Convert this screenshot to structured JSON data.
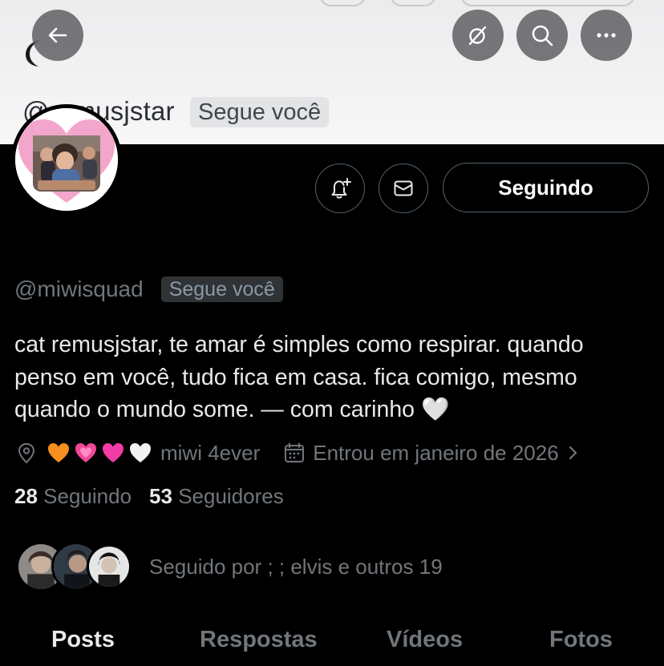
{
  "banner": {
    "back_icon": "arrow-left-icon",
    "moon_icon": "crescent-moon-icon",
    "ghost_handle": "@remusjstar",
    "ghost_badge": "Segue você",
    "actions": [
      {
        "icon": "grok-icon"
      },
      {
        "icon": "search-icon"
      },
      {
        "icon": "more-icon"
      }
    ]
  },
  "profile": {
    "handle": "@miwisquad",
    "follows_you_badge": "Segue você",
    "bio": "cat remusjstar, te amar é simples como respirar. quando penso em você, tudo fica em casa. fica comigo, mesmo quando o mundo some. — com carinho 🤍",
    "location_icon": "location-pin-icon",
    "location_emojis": [
      "orange-heart",
      "sparkling-heart",
      "pink-heart",
      "white-heart"
    ],
    "location_text": "miwi 4ever",
    "calendar_icon": "calendar-icon",
    "joined_text": "Entrou em janeiro de 2026",
    "following_count": "28",
    "following_label": "Seguindo",
    "followers_count": "53",
    "followers_label": "Seguidores",
    "followed_by_text": "Seguido por ; ; elvis e outros 19"
  },
  "buttons": {
    "notify_icon": "bell-plus-icon",
    "message_icon": "envelope-icon",
    "follow_label": "Seguindo"
  },
  "tabs": [
    {
      "label": "Posts",
      "active": true
    },
    {
      "label": "Respostas",
      "active": false
    },
    {
      "label": "Vídeos",
      "active": false
    },
    {
      "label": "Fotos",
      "active": false
    }
  ],
  "colors": {
    "background": "#000000",
    "text_primary": "#e7e9ea",
    "text_secondary": "#71767b",
    "border": "#536471",
    "heart_pink": "#f06ea8"
  }
}
